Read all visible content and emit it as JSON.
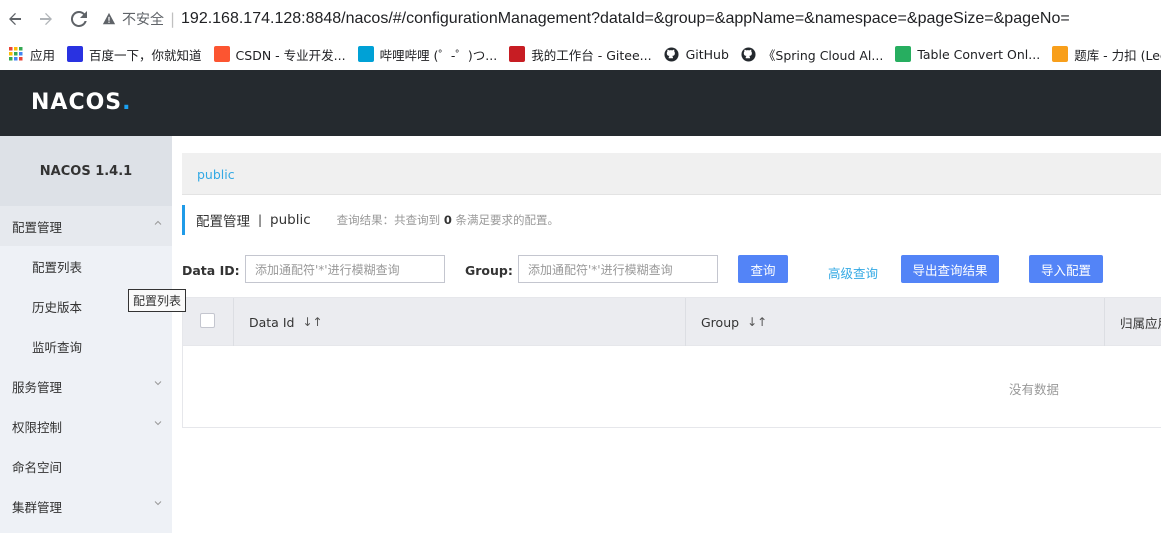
{
  "browser": {
    "insecure_label": "不安全",
    "url_host": "192.168.174.128:8848/nacos/#/configurationManagement?dataId=&group=&appName=&namespace=&pageSize=&pageNo=",
    "bookmarks": [
      {
        "label": "应用",
        "icon": "apps-grid-icon",
        "color": "#e04e39"
      },
      {
        "label": "百度一下，你就知道",
        "icon": "baidu-paw-icon",
        "color": "#2932e1"
      },
      {
        "label": "CSDN - 专业开发...",
        "icon": "csdn-icon",
        "color": "#fc5531"
      },
      {
        "label": "哔哩哔哩 (゜-゜)つ...",
        "icon": "bilibili-icon",
        "color": "#00a1d6"
      },
      {
        "label": "我的工作台 - Gitee...",
        "icon": "gitee-icon",
        "color": "#c71d23"
      },
      {
        "label": "GitHub",
        "icon": "github-icon",
        "color": "#24292e"
      },
      {
        "label": "《Spring Cloud Al...",
        "icon": "github-icon",
        "color": "#24292e"
      },
      {
        "label": "Table Convert Onl...",
        "icon": "table-convert-icon",
        "color": "#27ae60"
      },
      {
        "label": "题库 - 力扣 (Lee",
        "icon": "leetcode-icon",
        "color": "#f89f1b"
      }
    ]
  },
  "header": {
    "logo_text": "NACOS",
    "logo_dot": "."
  },
  "sidebar": {
    "version": "NACOS 1.4.1",
    "items": [
      {
        "label": "配置管理",
        "expanded": true
      },
      {
        "label": "配置列表",
        "sub": true
      },
      {
        "label": "历史版本",
        "sub": true
      },
      {
        "label": "监听查询",
        "sub": true
      },
      {
        "label": "服务管理",
        "expanded": false
      },
      {
        "label": "权限控制",
        "expanded": false
      },
      {
        "label": "命名空间"
      },
      {
        "label": "集群管理",
        "expanded": false
      }
    ],
    "tooltip": "配置列表"
  },
  "main": {
    "namespace_link": "public",
    "title": "配置管理",
    "title_sep": "|",
    "title_ns": "public",
    "result_prefix": "查询结果：共查询到",
    "result_count": "0",
    "result_suffix": "条满足要求的配置。",
    "search": {
      "dataid_label": "Data ID:",
      "dataid_placeholder": "添加通配符'*'进行模糊查询",
      "group_label": "Group:",
      "group_placeholder": "添加通配符'*'进行模糊查询",
      "query_button": "查询",
      "advanced_link": "高级查询",
      "export_button": "导出查询结果",
      "import_button": "导入配置"
    },
    "table": {
      "columns": [
        "Data Id",
        "Group",
        "归属应用"
      ],
      "empty_text": "没有数据"
    }
  }
}
